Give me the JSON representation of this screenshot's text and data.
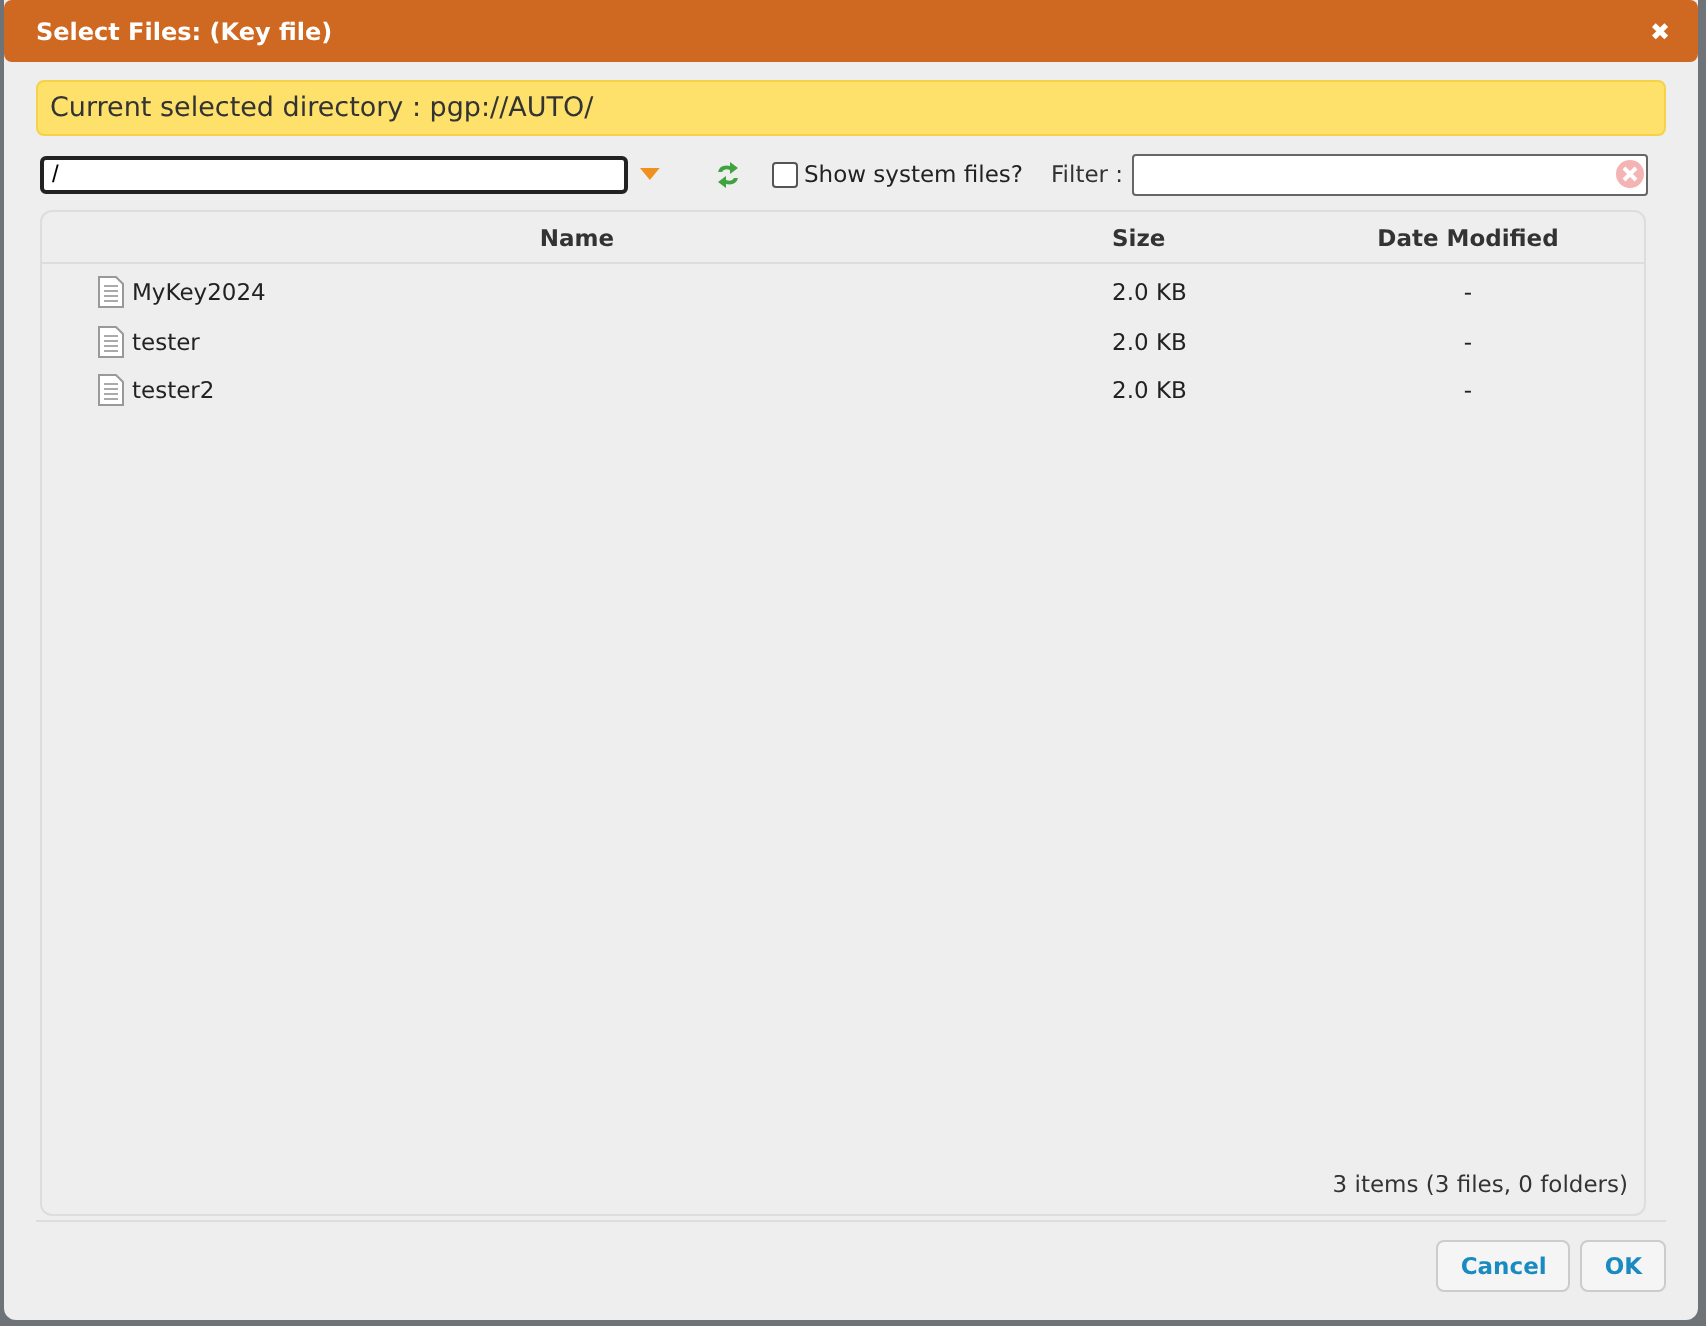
{
  "window": {
    "title": "Select Files: (Key file)",
    "close": "✖"
  },
  "directory_banner": "Current selected directory : pgp://AUTO/",
  "path_field": {
    "value": "/"
  },
  "show_system_files": {
    "label": "Show system files?",
    "checked": false
  },
  "filter": {
    "label": "Filter :"
  },
  "table": {
    "columns": [
      "Name",
      "Size",
      "Date Modified"
    ],
    "rows": [
      {
        "name": "MyKey2024",
        "size": "2.0 KB",
        "modified": "-"
      },
      {
        "name": "tester",
        "size": "2.0 KB",
        "modified": "-"
      },
      {
        "name": "tester2",
        "size": "2.0 KB",
        "modified": "-"
      }
    ]
  },
  "summary": "3 items (3 files, 0 folders)",
  "buttons": [
    "Cancel",
    "OK"
  ]
}
